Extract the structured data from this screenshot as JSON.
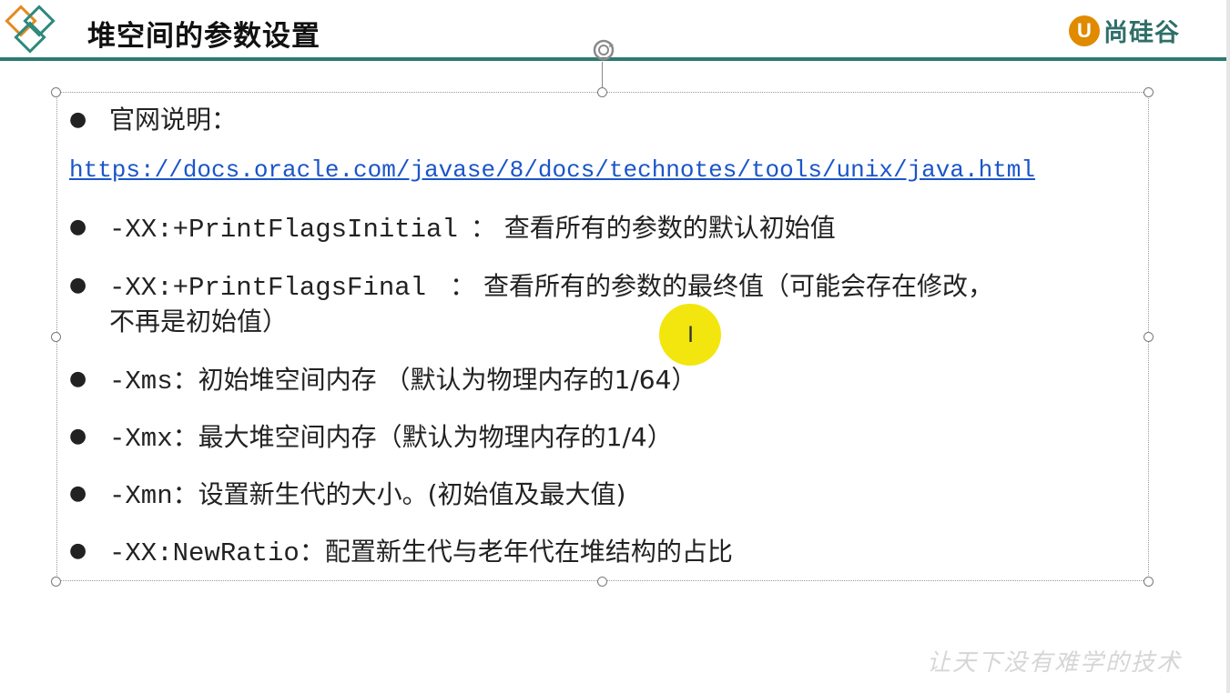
{
  "slide": {
    "title": "堆空间的参数设置",
    "brand": {
      "mark": "U",
      "name": "尚硅谷",
      "color": "#2e6f68"
    },
    "accent_color": "#2c7a72",
    "watermark": "让天下没有难学的技术"
  },
  "content": {
    "items": [
      {
        "label": "官网说明："
      },
      {
        "flag": "-XX:+PrintFlagsInitial",
        "desc": "： 查看所有的参数的默认初始值"
      },
      {
        "flag": "-XX:+PrintFlagsFinal",
        "desc": "： 查看所有的参数的最终值（可能会存在修改，",
        "desc2": "不再是初始值）"
      },
      {
        "flag": "-Xms",
        "desc": "：初始堆空间内存 （默认为物理内存的1/64）"
      },
      {
        "flag": "-Xmx",
        "desc": "：最大堆空间内存（默认为物理内存的1/4）"
      },
      {
        "flag": "-Xmn",
        "desc": "：设置新生代的大小。(初始值及最大值)"
      },
      {
        "flag": "-XX:NewRatio",
        "desc": "：配置新生代与老年代在堆结构的占比"
      }
    ],
    "link": "https://docs.oracle.com/javase/8/docs/technotes/tools/unix/java.html",
    "link_color": "#1a55c9"
  },
  "icons": {
    "logo": "diamond-logo-icon",
    "rotate": "rotate-handle-icon",
    "cursor": "text-cursor-icon"
  }
}
